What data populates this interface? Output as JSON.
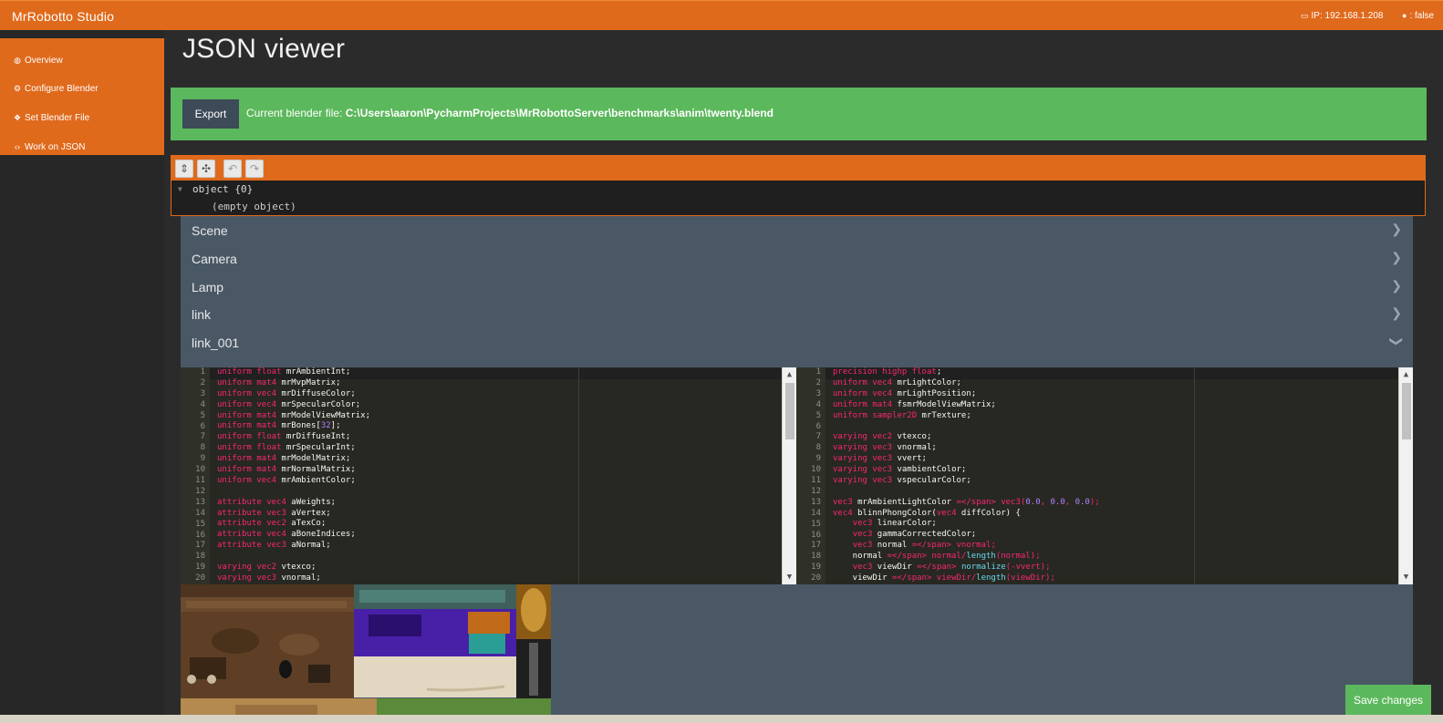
{
  "app": {
    "brand": "MrRobotto Studio",
    "ip_text": "IP: 192.168.1.208",
    "android_text": ": false"
  },
  "sidebar": {
    "items": [
      {
        "label": "Overview",
        "icon": "dashboard-icon"
      },
      {
        "label": "Configure Blender",
        "icon": "gears-icon"
      },
      {
        "label": "Set Blender File",
        "icon": "cubes-icon"
      },
      {
        "label": "Work on JSON",
        "icon": "code-icon"
      }
    ]
  },
  "main": {
    "title": "JSON viewer",
    "export_label": "Export",
    "blend_prefix": "Current blender file: ",
    "blend_path": "C:\\Users\\aaron\\PycharmProjects\\MrRobottoServer\\benchmarks\\anim\\twenty.blend",
    "json_editor": {
      "buttons": [
        "expand-all-icon",
        "collapse-all-icon",
        "undo-icon",
        "redo-icon"
      ],
      "root_text": "object {0}",
      "empty_text": "(empty object)"
    },
    "accordion": [
      {
        "title": "Scene",
        "expanded": false
      },
      {
        "title": "Camera",
        "expanded": false
      },
      {
        "title": "Lamp",
        "expanded": false
      },
      {
        "title": "link",
        "expanded": false
      },
      {
        "title": "link_001",
        "expanded": true
      }
    ],
    "save_label": "Save changes"
  },
  "vertex_shader": [
    "uniform float mrAmbientInt;",
    "uniform mat4 mrMvpMatrix;",
    "uniform vec4 mrDiffuseColor;",
    "uniform vec4 mrSpecularColor;",
    "uniform mat4 mrModelViewMatrix;",
    "uniform mat4 mrBones[32];",
    "uniform float mrDiffuseInt;",
    "uniform float mrSpecularInt;",
    "uniform mat4 mrModelMatrix;",
    "uniform mat4 mrNormalMatrix;",
    "uniform vec4 mrAmbientColor;",
    "",
    "attribute vec4 aWeights;",
    "attribute vec3 aVertex;",
    "attribute vec2 aTexCo;",
    "attribute vec4 aBoneIndices;",
    "attribute vec3 aNormal;",
    "",
    "varying vec2 vtexco;",
    "varying vec3 vnormal;"
  ],
  "fragment_shader": [
    "precision highp float;",
    "uniform vec4 mrLightColor;",
    "uniform vec4 mrLightPosition;",
    "uniform mat4 fsmrModelViewMatrix;",
    "uniform sampler2D mrTexture;",
    "",
    "varying vec2 vtexco;",
    "varying vec3 vnormal;",
    "varying vec3 vvert;",
    "varying vec3 vambientColor;",
    "varying vec3 vspecularColor;",
    "",
    "vec3 mrAmbientLightColor = vec3(0.0, 0.0, 0.0);",
    "vec4 blinnPhongColor(vec4 diffColor) {",
    "    vec3 linearColor;",
    "    vec3 gammaCorrectedColor;",
    "    vec3 normal = vnormal;",
    "    normal = normal/length(normal);",
    "    vec3 viewDir = normalize(-vvert);",
    "    viewDir = viewDir/length(viewDir);"
  ],
  "colors": {
    "brand_orange": "#e06a1c",
    "success_green": "#5cb85c",
    "panel_slate": "#4a5866",
    "editor_bg": "#272822"
  }
}
